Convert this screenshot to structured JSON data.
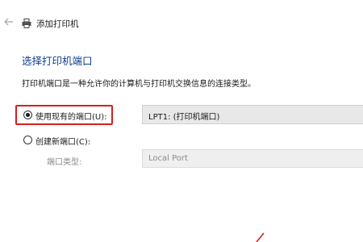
{
  "window": {
    "title": "添加打印机",
    "back_icon": "arrow-left-icon",
    "app_icon": "printer-icon"
  },
  "page": {
    "heading": "选择打印机端口",
    "description": "打印机端口是一种允许你的计算机与打印机交换信息的连接类型。"
  },
  "options": {
    "use_existing": {
      "label": "使用现有的端口(U):",
      "checked": true,
      "selected_value": "LPT1: (打印机端口)"
    },
    "create_new": {
      "label": "创建新端口(C):",
      "checked": false,
      "port_type_label": "端口类型:",
      "port_type_value": "Local Port"
    }
  },
  "colors": {
    "heading": "#0e3f8c",
    "highlight": "#d42020"
  }
}
